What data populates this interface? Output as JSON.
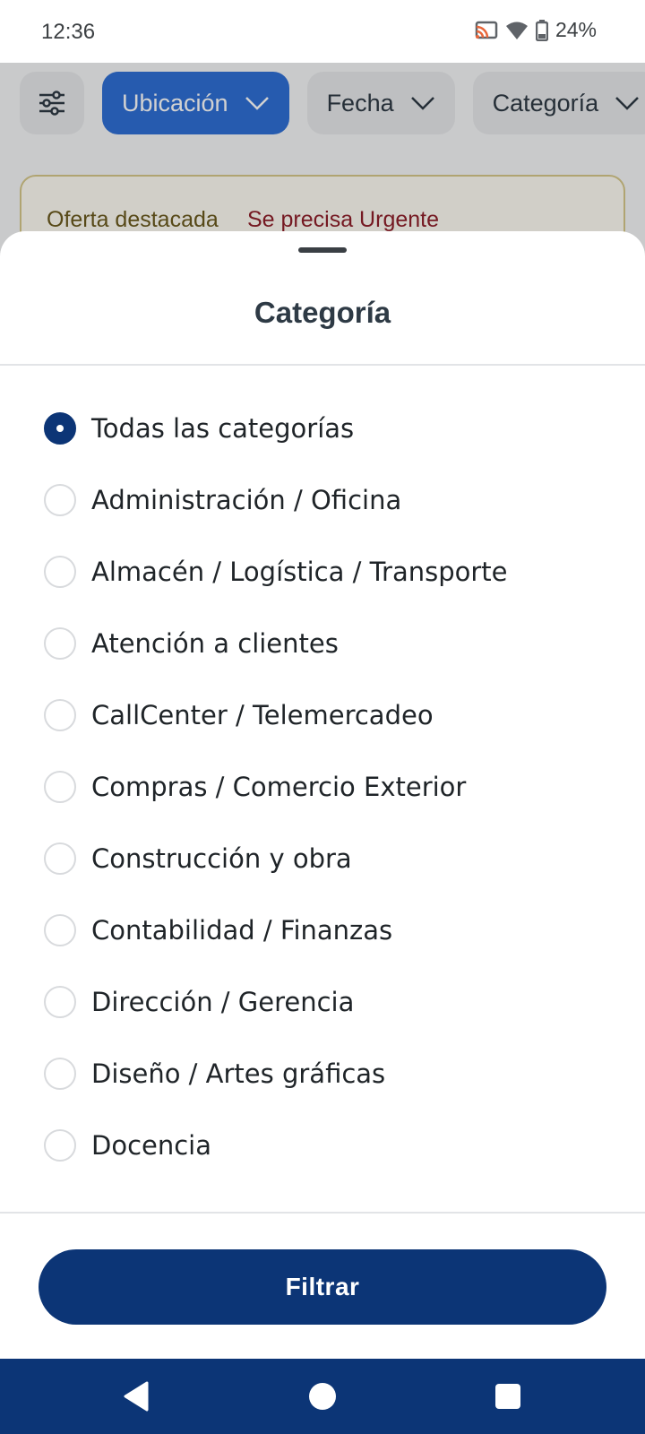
{
  "status_bar": {
    "time": "12:36",
    "battery": "24%",
    "icons": [
      "cast-icon",
      "wifi-icon",
      "battery-icon"
    ]
  },
  "background": {
    "chips": [
      {
        "label": "",
        "icon": "filter-sliders-icon"
      },
      {
        "label": "Ubicación",
        "active": true
      },
      {
        "label": "Fecha"
      },
      {
        "label": "Categoría"
      }
    ],
    "offer_card": {
      "featured": "Oferta destacada",
      "urgent": "Se precisa Urgente"
    }
  },
  "sheet": {
    "title": "Categoría",
    "options": [
      {
        "label": "Todas las categorías",
        "selected": true
      },
      {
        "label": "Administración / Oficina",
        "selected": false
      },
      {
        "label": "Almacén / Logística / Transporte",
        "selected": false
      },
      {
        "label": "Atención a clientes",
        "selected": false
      },
      {
        "label": "CallCenter / Telemercadeo",
        "selected": false
      },
      {
        "label": "Compras / Comercio Exterior",
        "selected": false
      },
      {
        "label": "Construcción y obra",
        "selected": false
      },
      {
        "label": "Contabilidad / Finanzas",
        "selected": false
      },
      {
        "label": "Dirección / Gerencia",
        "selected": false
      },
      {
        "label": "Diseño / Artes gráficas",
        "selected": false
      },
      {
        "label": "Docencia",
        "selected": false
      }
    ],
    "filter_button": "Filtrar"
  },
  "nav_bar": {
    "icons": [
      "back-icon",
      "home-icon",
      "recents-icon"
    ]
  },
  "colors": {
    "primary": "#0c3576",
    "chip_active": "#2f6fd6",
    "urgent": "#8f1f2a"
  }
}
